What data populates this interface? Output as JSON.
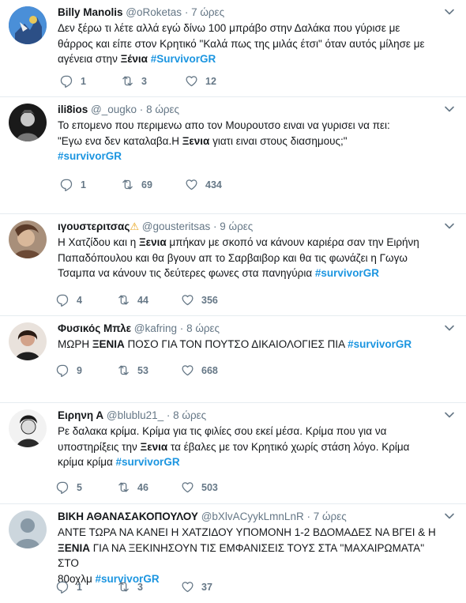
{
  "colors": {
    "link": "#1b95e0",
    "muted": "#657786",
    "text": "#14171a",
    "divider": "#e6ecf0"
  },
  "tweets": [
    {
      "name": "Billy Manolis",
      "handle": "@oRoketas",
      "time": "7 ώρες",
      "text": [
        "Δεν ξέρω τι λέτε αλλά εγώ δίνω 100 μπράβο στην Δαλάκα που γύρισε με",
        "θάρρος και είπε στον Κρητικό \"Καλά πως της μιλάς έτσι\" όταν αυτός μίλησε με",
        "αγένεια στην "
      ],
      "bold_word": "Ξένια",
      "hashtag": "#SurvivorGR",
      "replies": "1",
      "retweets": "3",
      "likes": "12"
    },
    {
      "name": "ili8ios",
      "handle": "@_ougko",
      "time": "8 ώρες",
      "text": [
        "Το επομενο που περιμενω απο τον Μουρουτσο ειναι να γυρισει να πει:",
        "\"Εγω ενα δεν καταλαβα.Η "
      ],
      "bold_word": "Ξενια",
      "text_after": " γιατι ειναι στους διασημους;\"",
      "hashtag": "#survivorGR",
      "replies": "1",
      "retweets": "69",
      "likes": "434"
    },
    {
      "name": "ιγουστεριτσας",
      "warn_icon": "warning-icon",
      "handle": "@gousteritsas",
      "time": "9 ώρες",
      "line1_pre": "Η Χατζίδου και η ",
      "bold_word": "Ξενια",
      "line1_post": " μπήκαν με σκοπό να κάνουν καριέρα σαν την Ειρήνη",
      "line2": "Παπαδόπουλου και θα βγουν απ το Σαρβαιβορ και θα τις φωνάζει η Γωγω",
      "line3": "Τσαμπα να κάνουν τις δεύτερες φωνες στα πανηγύρια ",
      "hashtag": "#survivorGR",
      "replies": "4",
      "retweets": "44",
      "likes": "356"
    },
    {
      "name": "Φυσικός Μπλε",
      "handle": "@kafring",
      "time": "8 ώρες",
      "pre": "ΜΩΡΗ ",
      "bold_word": "ΞΕΝΙΑ",
      "post": " ΠΟΣΟ ΓΙΑ ΤΟΝ ΠΟΥΤΣΟ ΔΙΚΑΙΟΛΟΓΙΕΣ ΠΙΑ ",
      "hashtag": "#survivorGR",
      "replies": "9",
      "retweets": "53",
      "likes": "668"
    },
    {
      "name": "Ειρηνη Α",
      "handle": "@blublu21_",
      "time": "8 ώρες",
      "line1": "Ρε δαλακα κρίμα. Κρίμα για τις φιλίες σου εκεί μέσα. Κρίμα που για να",
      "line2_pre": "υποστηρίξεις την ",
      "bold_word": "Ξενια",
      "line2_post": " τα έβαλες με τον Κρητικό χωρίς στάση λόγο. Κρίμα",
      "line3": "κρίμα κρίμα ",
      "hashtag": "#survivorGR",
      "replies": "5",
      "retweets": "46",
      "likes": "503"
    },
    {
      "name": "ΒΙΚΗ ΑΘΑΝΑΣΑΚΟΠΟΥΛΟΥ",
      "handle": "@bXlvACyykLmnLnR",
      "time": "7 ώρες",
      "line1": "ΑΝΤΕ ΤΩΡΑ ΝΑ ΚΑΝΕΙ Η ΧΑΤΖΙΔΟΥ ΥΠΟΜΟΝΗ 1-2 ΒΔΟΜΑΔΕΣ ΝΑ ΒΓΕΙ & Η",
      "bold_word": "ΞΕΝΙΑ",
      "line2_post": " ΓΙΑ ΝΑ ΞΕΚΙΝΗΣΟΥΝ ΤΙΣ ΕΜΦΑΝΙΣΕΙΣ ΤΟΥΣ ΣΤΑ ''ΜΑΧΑΙΡΩΜΑΤΑ'' ΣΤΟ",
      "line3": "80οχλμ ",
      "hashtag": "#survivorGR",
      "replies": "1",
      "retweets": "3",
      "likes": "37"
    }
  ]
}
